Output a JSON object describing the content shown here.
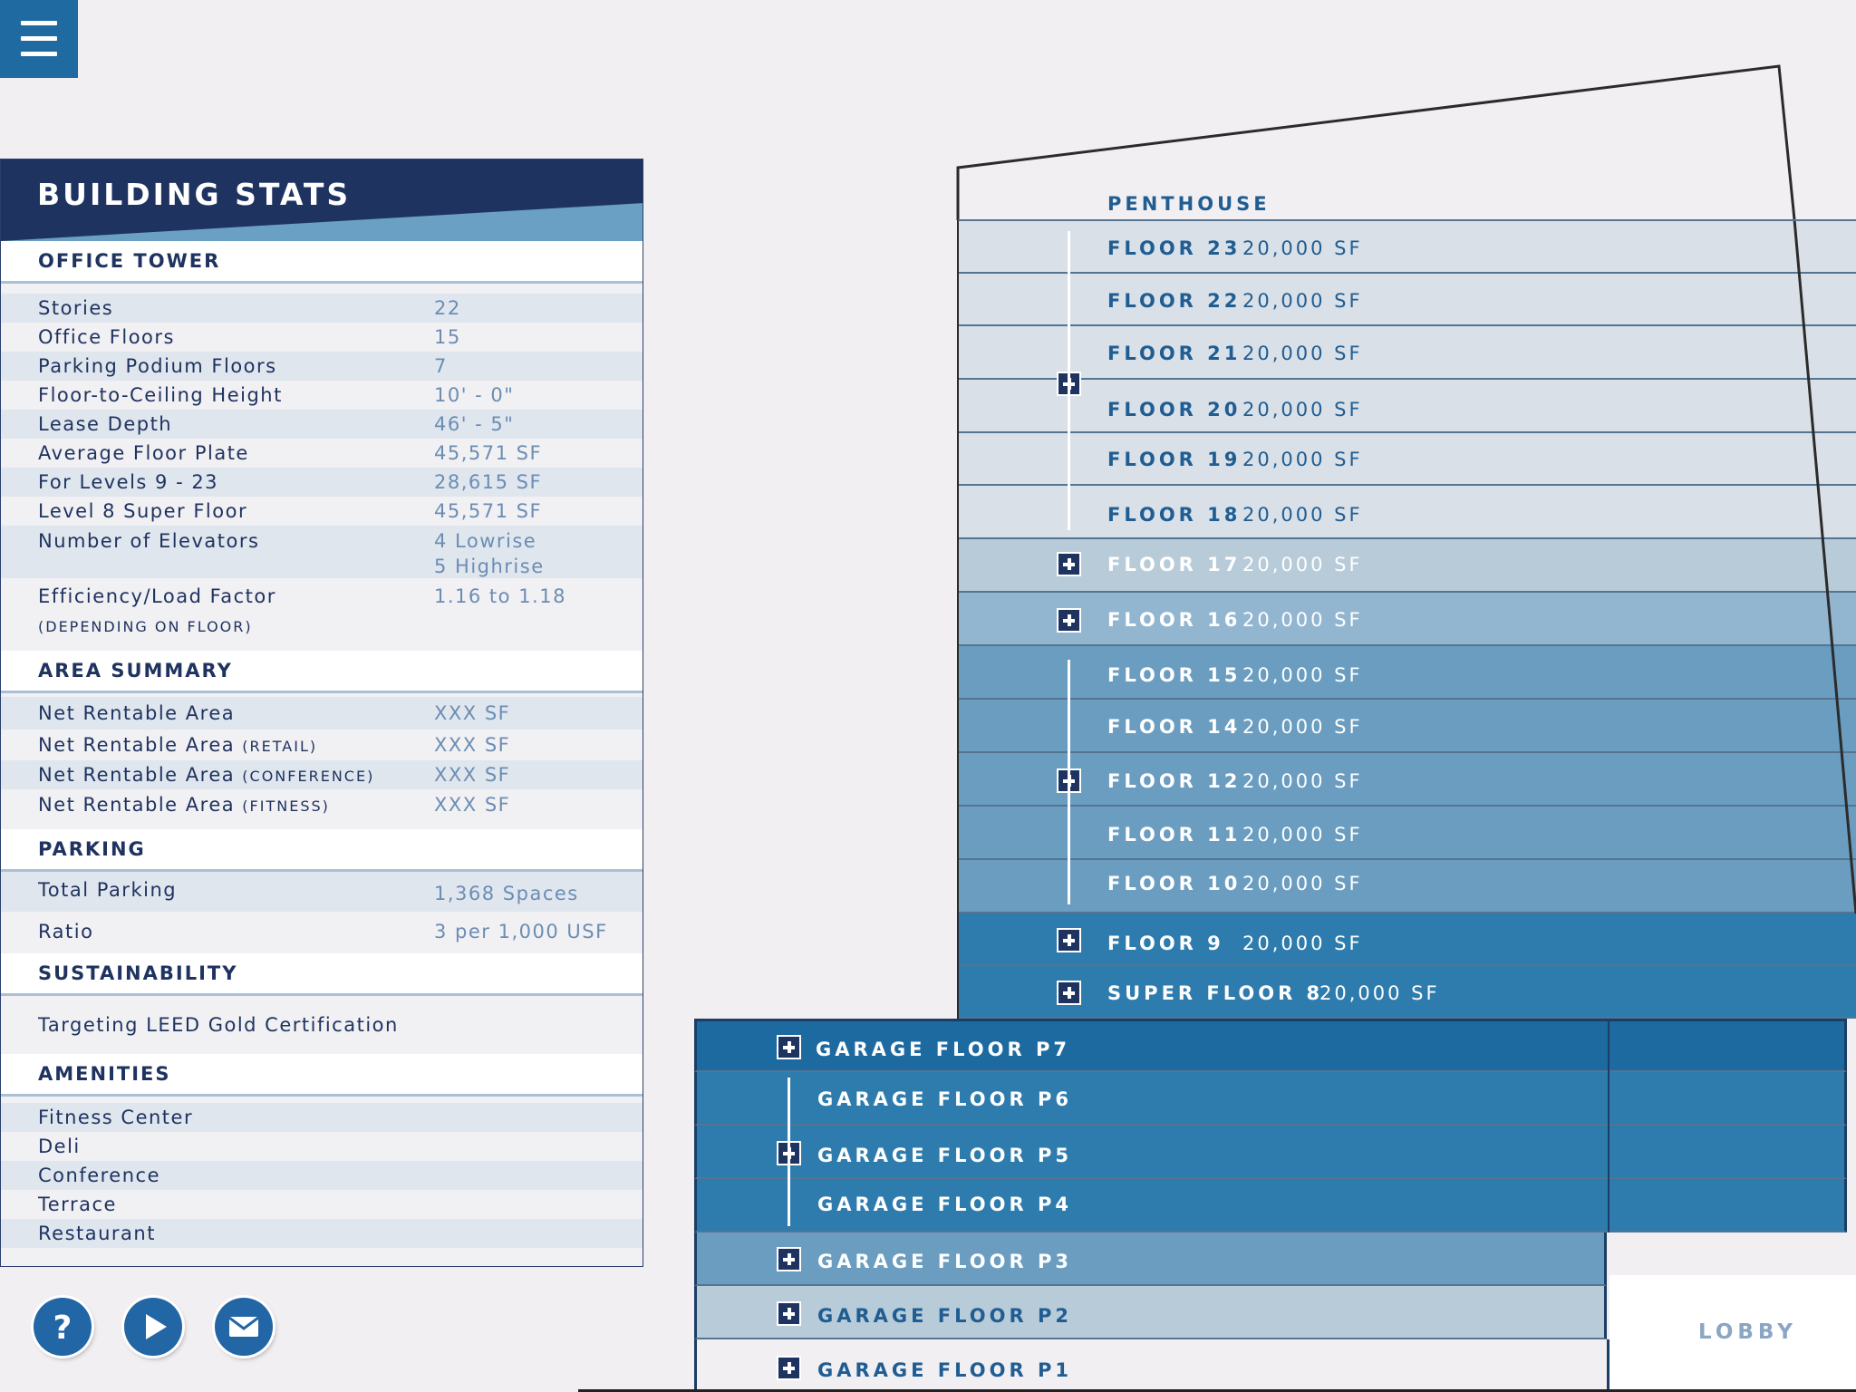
{
  "menu": {
    "icon": "hamburger-menu-icon"
  },
  "panel": {
    "title": "BUILDING STATS",
    "office_tower": {
      "title": "OFFICE TOWER",
      "rows": [
        {
          "label": "Stories",
          "value": "22"
        },
        {
          "label": "Office Floors",
          "value": "15"
        },
        {
          "label": "Parking Podium Floors",
          "value": "7"
        },
        {
          "label": "Floor-to-Ceiling Height",
          "value": "10' - 0\""
        },
        {
          "label": "Lease Depth",
          "value": "46' - 5\""
        },
        {
          "label": "Average Floor Plate",
          "value": "45,571 SF"
        },
        {
          "label": "For Levels 9 - 23",
          "value": "28,615 SF"
        },
        {
          "label": "Level 8 Super Floor",
          "value": "45,571 SF"
        },
        {
          "label": "Number of Elevators",
          "value": "4 Lowrise",
          "value2": "5 Highrise"
        },
        {
          "label": "Efficiency/Load Factor",
          "value": "1.16 to 1.18",
          "note": "(DEPENDING ON FLOOR)"
        }
      ]
    },
    "area_summary": {
      "title": "AREA SUMMARY",
      "rows": [
        {
          "label": "Net Rentable Area",
          "note": "",
          "value": "XXX SF"
        },
        {
          "label": "Net Rentable Area",
          "note": "(RETAIL)",
          "value": "XXX SF"
        },
        {
          "label": "Net Rentable Area",
          "note": "(CONFERENCE)",
          "value": "XXX SF"
        },
        {
          "label": "Net Rentable Area",
          "note": "(FITNESS)",
          "value": "XXX SF"
        }
      ]
    },
    "parking": {
      "title": "PARKING",
      "rows": [
        {
          "label": "Total Parking",
          "value": "1,368 Spaces"
        },
        {
          "label": "Ratio",
          "value": "3 per 1,000 USF"
        }
      ]
    },
    "sustainability": {
      "title": "SUSTAINABILITY",
      "text": "Targeting LEED Gold Certification"
    },
    "amenities": {
      "title": "AMENITIES",
      "items": [
        "Fitness Center",
        "Deli",
        "Conference",
        "Terrace",
        "Restaurant"
      ]
    }
  },
  "bottom_buttons": [
    {
      "name": "help-button",
      "icon": "question-icon"
    },
    {
      "name": "play-button",
      "icon": "play-icon"
    },
    {
      "name": "email-button",
      "icon": "envelope-icon"
    }
  ],
  "building": {
    "penthouse": "PENTHOUSE",
    "lobby": "LOBBY",
    "floors": [
      {
        "label": "FLOOR 23",
        "sf": "20,000 SF"
      },
      {
        "label": "FLOOR 22",
        "sf": "20,000 SF"
      },
      {
        "label": "FLOOR 21",
        "sf": "20,000 SF"
      },
      {
        "label": "FLOOR 20",
        "sf": "20,000 SF"
      },
      {
        "label": "FLOOR 19",
        "sf": "20,000 SF"
      },
      {
        "label": "FLOOR 18",
        "sf": "20,000 SF"
      },
      {
        "label": "FLOOR 17",
        "sf": "20,000 SF"
      },
      {
        "label": "FLOOR 16",
        "sf": "20,000 SF"
      },
      {
        "label": "FLOOR 15",
        "sf": "20,000 SF"
      },
      {
        "label": "FLOOR 14",
        "sf": "20,000 SF"
      },
      {
        "label": "FLOOR 12",
        "sf": "20,000 SF"
      },
      {
        "label": "FLOOR 11",
        "sf": "20,000 SF"
      },
      {
        "label": "FLOOR 10",
        "sf": "20,000 SF"
      },
      {
        "label": "FLOOR 9",
        "sf": "20,000 SF"
      },
      {
        "label": "SUPER FLOOR 8",
        "sf": "20,000 SF"
      }
    ],
    "garage": [
      {
        "label": "GARAGE FLOOR P7"
      },
      {
        "label": "GARAGE FLOOR P6"
      },
      {
        "label": "GARAGE FLOOR P5"
      },
      {
        "label": "GARAGE FLOOR P4"
      },
      {
        "label": "GARAGE FLOOR P3"
      },
      {
        "label": "GARAGE FLOOR P2"
      },
      {
        "label": "GARAGE FLOOR P1"
      }
    ],
    "colors": {
      "light": "#d9e0e8",
      "pale": "#b7cbd9",
      "soft": "#93b6d0",
      "mid": "#6a9dc0",
      "deep": "#2e7cae",
      "darkest": "#1d6aa0",
      "label_dark": "#1f5d92"
    }
  }
}
